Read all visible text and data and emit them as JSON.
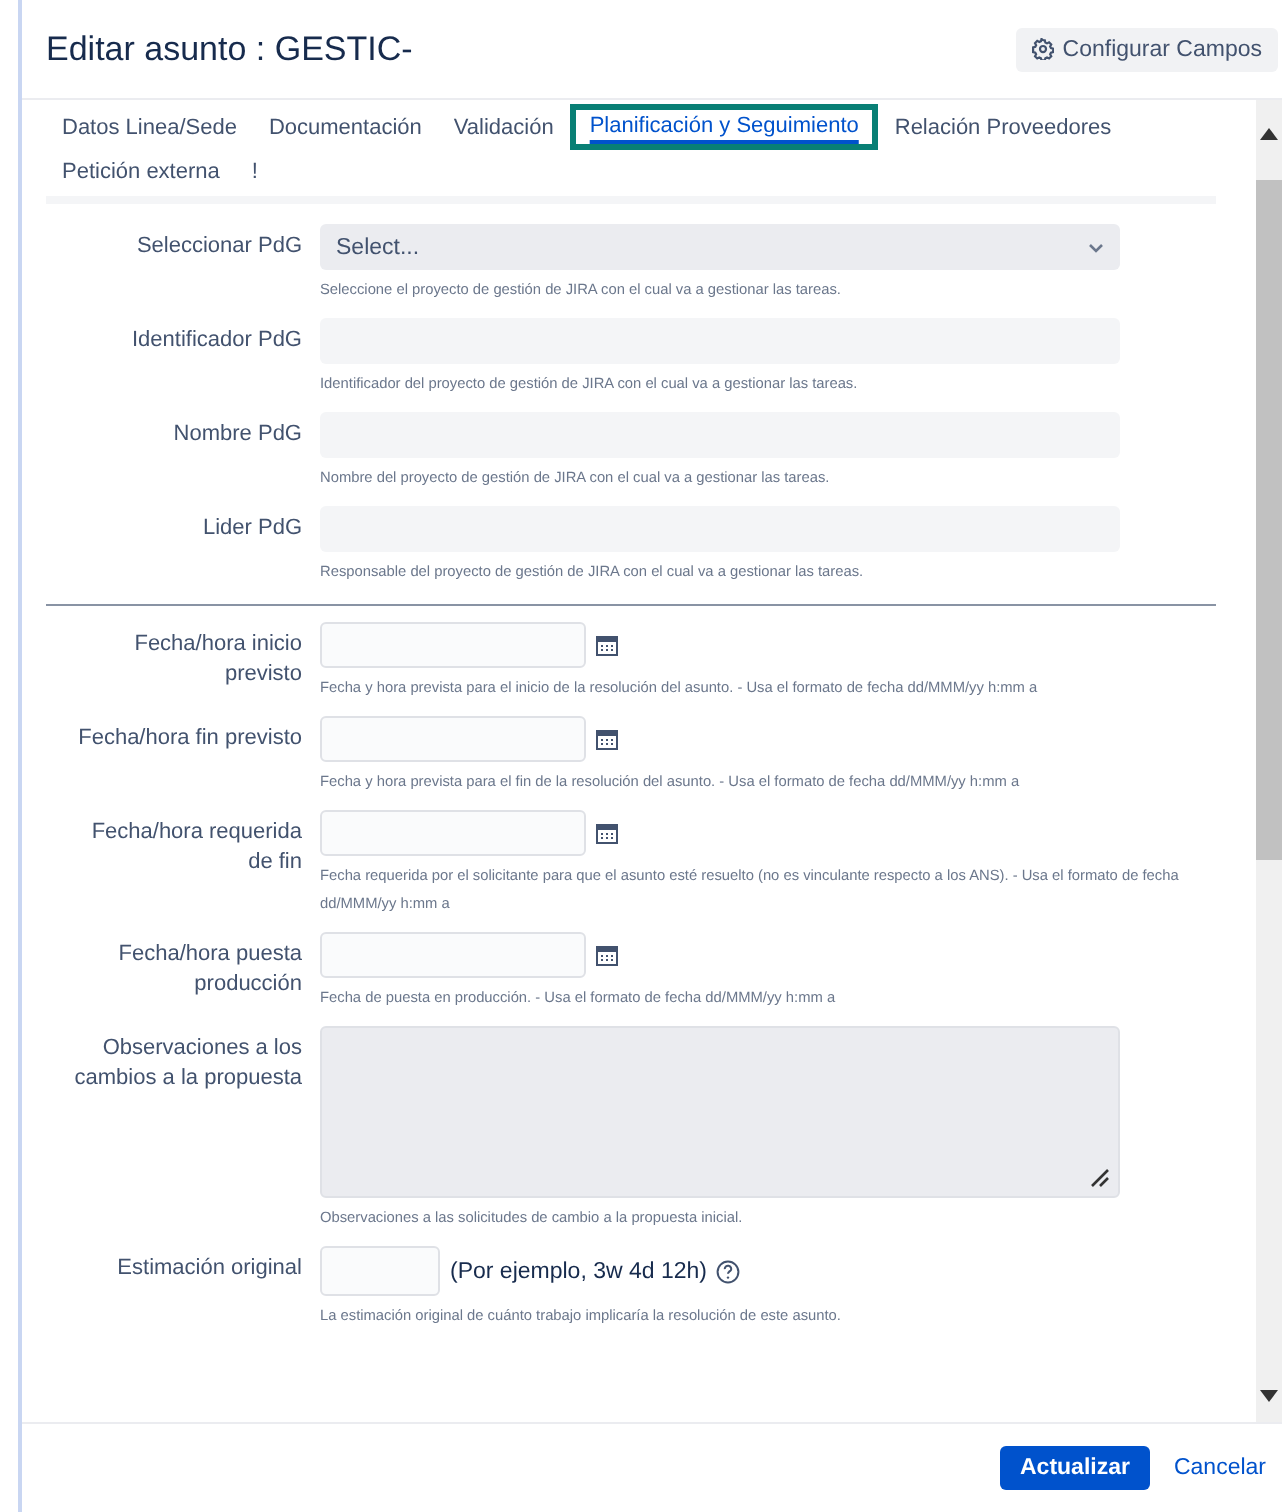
{
  "dialog": {
    "title": "Editar asunto : GESTIC-",
    "configure_button": "Configurar Campos"
  },
  "tabs": [
    {
      "label": "Datos Linea/Sede",
      "selected": false
    },
    {
      "label": "Documentación",
      "selected": false
    },
    {
      "label": "Validación",
      "selected": false
    },
    {
      "label": "Planificación y Seguimiento",
      "selected": true
    },
    {
      "label": "Relación Proveedores",
      "selected": false
    },
    {
      "label": "Petición externa",
      "selected": false
    },
    {
      "label": "!",
      "selected": false
    }
  ],
  "fields": [
    {
      "kind": "select",
      "label": "Seleccionar PdG",
      "placeholder": "Select...",
      "hint": "Seleccione el proyecto de gestión de JIRA con el cual va a gestionar las tareas."
    },
    {
      "kind": "text",
      "label": "Identificador PdG",
      "hint": "Identificador del proyecto de gestión de JIRA con el cual va a gestionar las tareas."
    },
    {
      "kind": "text",
      "label": "Nombre PdG",
      "hint": "Nombre del proyecto de gestión de JIRA con el cual va a gestionar las tareas."
    },
    {
      "kind": "text",
      "label": "Lider PdG",
      "hint": "Responsable del proyecto de gestión de JIRA con el cual va a gestionar las tareas."
    },
    {
      "kind": "divider"
    },
    {
      "kind": "date",
      "label": "Fecha/hora inicio previsto",
      "hint": "Fecha y hora prevista para el inicio de la resolución del asunto. - Usa el formato de fecha dd/MMM/yy h:mm a"
    },
    {
      "kind": "date",
      "label": "Fecha/hora fin previsto",
      "hint": "Fecha y hora prevista para el fin de la resolución del asunto. - Usa el formato de fecha dd/MMM/yy h:mm a"
    },
    {
      "kind": "date",
      "label": "Fecha/hora requerida de fin",
      "hint": "Fecha requerida por el solicitante para que el asunto esté resuelto (no es vinculante respecto a los ANS). - Usa el formato de fecha dd/MMM/yy h:mm a"
    },
    {
      "kind": "date",
      "label": "Fecha/hora puesta producción",
      "hint": "Fecha de puesta en producción. - Usa el formato de fecha dd/MMM/yy h:mm a"
    },
    {
      "kind": "textarea",
      "label": "Observaciones a los cambios a la propuesta",
      "hint": "Observaciones a las solicitudes de cambio a la propuesta inicial."
    },
    {
      "kind": "duration",
      "label": "Estimación original",
      "example": "(Por ejemplo, 3w 4d 12h)",
      "hint": "La estimación original de cuánto trabajo implicaría la resolución de este asunto."
    }
  ],
  "footer": {
    "submit": "Actualizar",
    "cancel": "Cancelar"
  }
}
